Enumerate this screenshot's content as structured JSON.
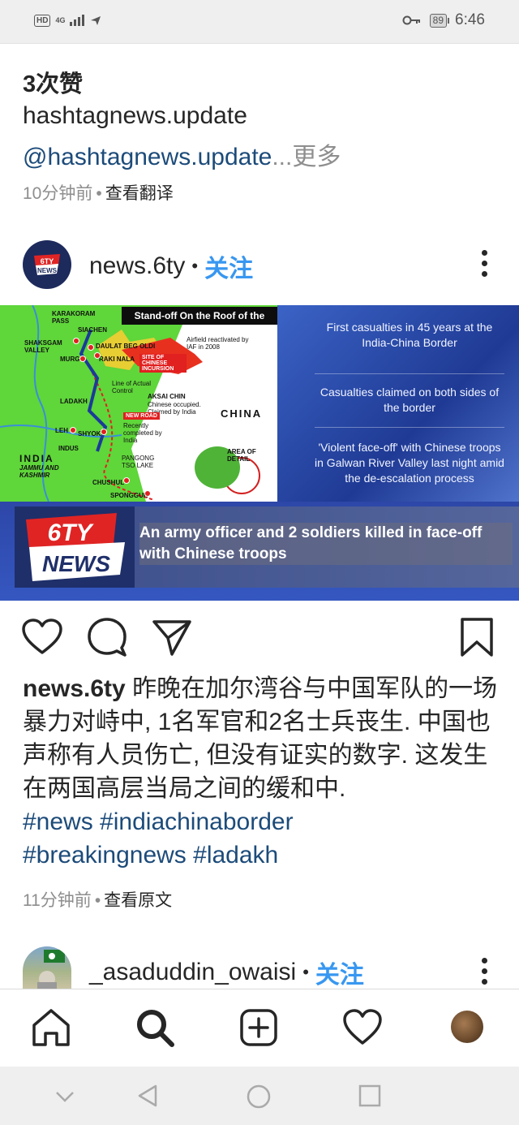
{
  "status_bar": {
    "hd": "HD",
    "network": "4G",
    "battery": "89",
    "time": "6:46"
  },
  "prev_post": {
    "likes": "3次赞",
    "username": "hashtagnews.update",
    "mention": "@hashtagnews.update",
    "ellipsis": "...",
    "more": "更多",
    "time": "10分钟前",
    "separator": "•",
    "translate": "查看翻译"
  },
  "post": {
    "username": "news.6ty",
    "separator": "•",
    "follow": "关注",
    "image": {
      "map_title": "Stand-off On the Roof of the World",
      "labels": {
        "karakoram": "KARAKORAM PASS",
        "siachen": "SIACHEN",
        "shaksgam": "SHAKSGAM VALLEY",
        "dbo": "DAULAT BEG OLDI",
        "airfield": "Airfield reactivated by IAF in 2008",
        "murgo": "MURGO",
        "raki": "RAKI NALA",
        "incursion": "SITE OF CHINESE INCURSION",
        "lac": "Line of Actual Control",
        "aksai": "AKSAI CHIN",
        "aksai_note": "Chinese occupied. Claimed by India",
        "ladakh": "LADAKH",
        "new_road": "NEW ROAD",
        "road_note": "Recently completed by India",
        "leh": "LEH",
        "shyok": "SHYOK",
        "indus": "INDUS",
        "china": "CHINA",
        "india": "INDIA",
        "jk": "JAMMU AND KASHMIR",
        "pangong": "PANGONG TSO LAKE",
        "area_detail": "AREA OF DETAIL",
        "chushul": "CHUSHUL",
        "spanggur": "SPONGGUR"
      },
      "facts": [
        "First casualties in 45 years at the India-China Border",
        "Casualties claimed on both sides of the border",
        "'Violent face-off' with Chinese troops in Galwan River Valley last night amid the de-escalation process"
      ],
      "brand_top": "6TY",
      "brand_bottom": "NEWS",
      "headline": "An army officer and 2 soldiers killed in face-off with Chinese troops"
    },
    "caption_user": "news.6ty",
    "caption_text": "昨晚在加尔湾谷与中国军队的一场暴力对峙中, 1名军官和2名士兵丧生. 中国也声称有人员伤亡, 但没有证实的数字. 这发生在两国高层当局之间的缓和中.",
    "hashtags_line1": "#news #indiachinaborder",
    "hashtags_line2": "#breakingnews #ladakh",
    "time": "11分钟前",
    "meta_separator": "•",
    "original": "查看原文"
  },
  "next_post": {
    "username": "_asaduddin_owaisi",
    "separator": "•",
    "follow": "关注"
  },
  "bottom_nav": {
    "items": [
      "home-icon",
      "search-icon",
      "add-post-icon",
      "activity-heart-icon",
      "profile-avatar"
    ]
  },
  "colors": {
    "link_blue": "#3897f0",
    "hashtag_blue": "#1c4b7a",
    "muted": "#8e8e8e"
  }
}
